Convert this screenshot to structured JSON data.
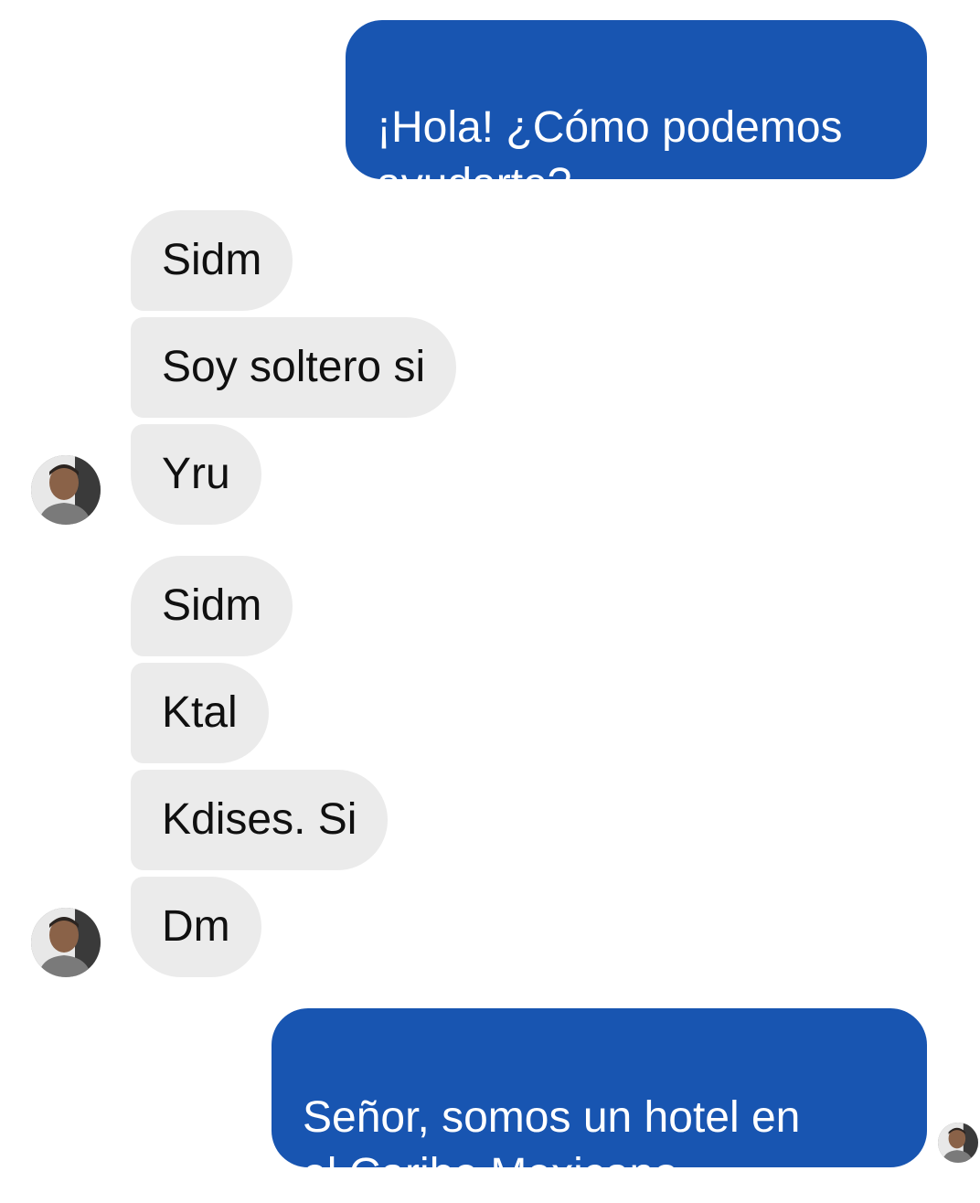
{
  "conversation": {
    "messages": [
      {
        "direction": "outgoing",
        "text": "¡Hola! ¿Cómo podemos\nayudarte?"
      },
      {
        "direction": "incoming",
        "text": "Sidm"
      },
      {
        "direction": "incoming",
        "text": "Soy soltero si"
      },
      {
        "direction": "incoming",
        "text": "Yru"
      },
      {
        "direction": "incoming",
        "text": "Sidm"
      },
      {
        "direction": "incoming",
        "text": "Ktal"
      },
      {
        "direction": "incoming",
        "text": "Kdises. Si"
      },
      {
        "direction": "incoming",
        "text": "Dm"
      },
      {
        "direction": "outgoing",
        "text": "Señor, somos un hotel en\nel Caribe Mexicano."
      }
    ]
  },
  "colors": {
    "outgoing_bubble": "#1855b1",
    "incoming_bubble": "#ebebeb",
    "outgoing_text": "#ffffff",
    "incoming_text": "#101010"
  },
  "icons": {
    "sender_avatar": "avatar-photo-icon",
    "seen_receipt": "seen-avatar-icon"
  }
}
